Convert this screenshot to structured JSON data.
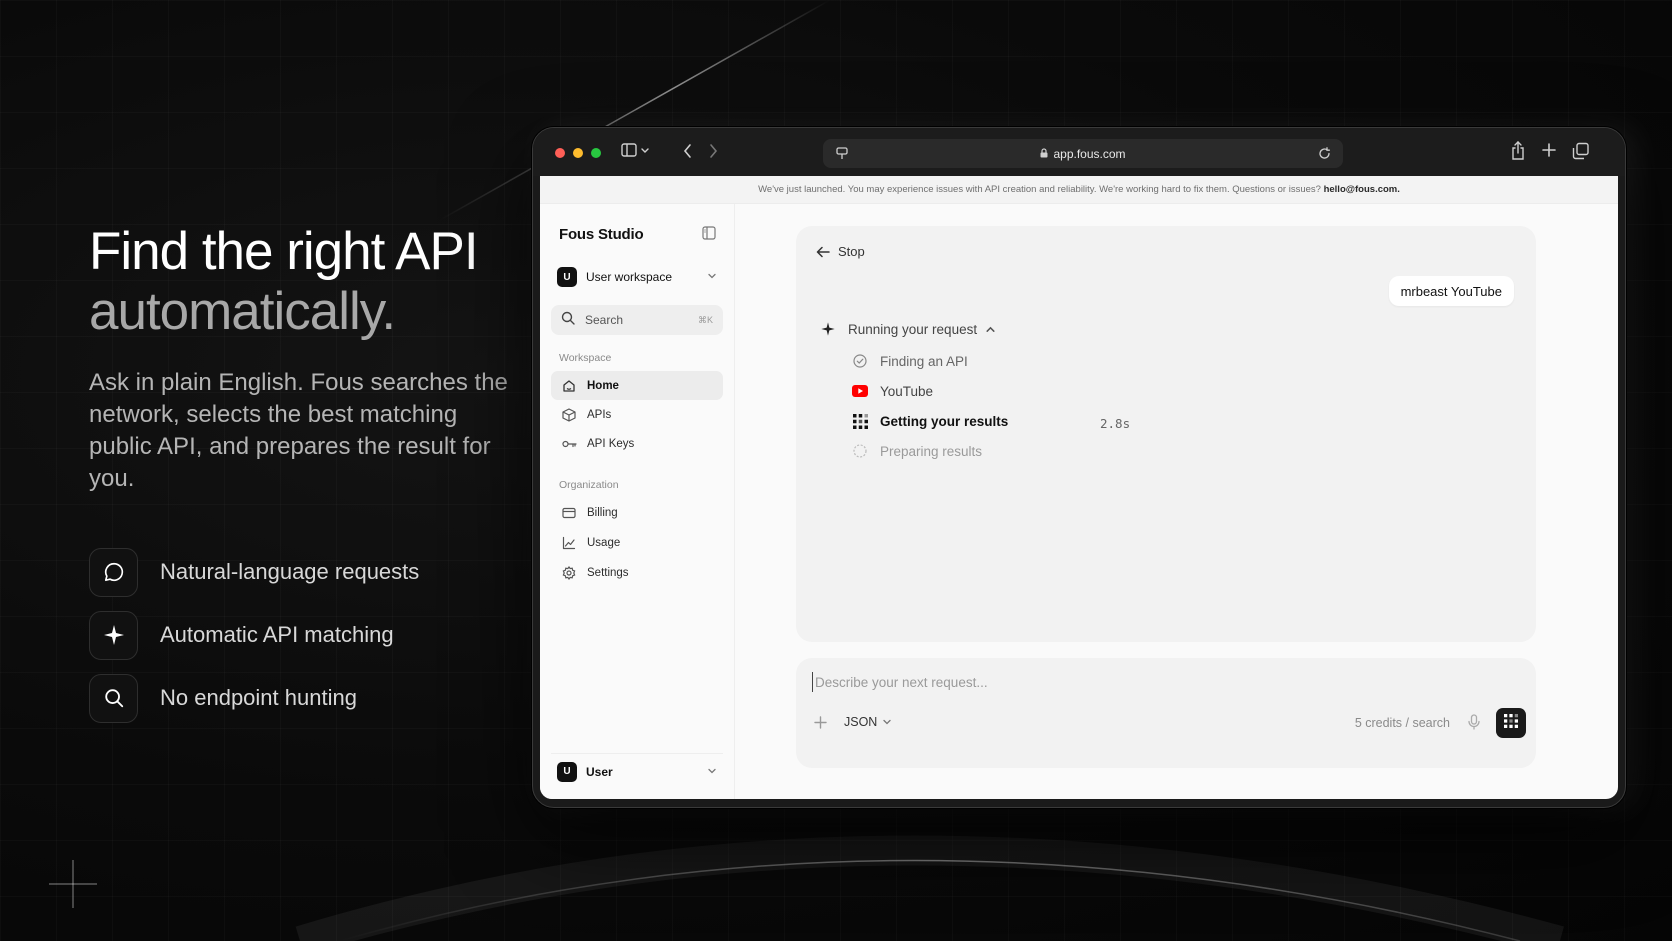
{
  "hero": {
    "title_line1": "Find the right API",
    "title_line2": "automatically.",
    "description": "Ask in plain English. Fous searches the network, selects the best matching public API, and prepares the result for you."
  },
  "features": [
    {
      "icon": "chat-bubble-icon",
      "label": "Natural-language requests"
    },
    {
      "icon": "sparkle-icon",
      "label": "Automatic API matching"
    },
    {
      "icon": "search-icon",
      "label": "No endpoint hunting"
    }
  ],
  "browser": {
    "url": "app.fous.com",
    "traffic_colors": [
      "#ff5f57",
      "#febc2e",
      "#28c840"
    ]
  },
  "banner": {
    "text": "We've just launched. You may experience issues with API creation and reliability. We're working hard to fix them. Questions or issues? ",
    "email": "hello@fous.com."
  },
  "sidebar": {
    "brand": "Fous Studio",
    "workspace": {
      "avatar": "U",
      "label": "User workspace"
    },
    "search": {
      "placeholder": "Search",
      "shortcut": "⌘K"
    },
    "workspace_section": {
      "label": "Workspace",
      "items": [
        {
          "icon": "home-icon",
          "label": "Home",
          "active": true
        },
        {
          "icon": "cube-icon",
          "label": "APIs"
        },
        {
          "icon": "key-icon",
          "label": "API Keys"
        }
      ]
    },
    "organization_section": {
      "label": "Organization",
      "items": [
        {
          "icon": "card-icon",
          "label": "Billing"
        },
        {
          "icon": "chart-icon",
          "label": "Usage"
        },
        {
          "icon": "gear-icon",
          "label": "Settings"
        }
      ]
    },
    "user": {
      "avatar": "U",
      "label": "User"
    }
  },
  "chat": {
    "stop_label": "Stop",
    "user_message": "mrbeast YouTube",
    "run_title": "Running your request",
    "steps": [
      {
        "label": "Finding an API",
        "status": "done"
      },
      {
        "label": "YouTube",
        "status": "source"
      },
      {
        "label": "Getting your results",
        "status": "active",
        "elapsed": "2.8s"
      },
      {
        "label": "Preparing results",
        "status": "pending"
      }
    ]
  },
  "composer": {
    "placeholder": "Describe your next request...",
    "format": "JSON",
    "credits": "5 credits / search"
  },
  "colors": {
    "accent": "#111111",
    "youtube": "#ff0000",
    "background": "#0a0a0a"
  }
}
